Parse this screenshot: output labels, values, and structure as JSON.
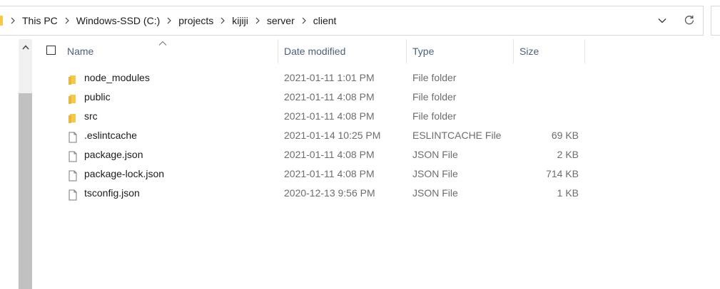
{
  "address_bar": {
    "breadcrumbs": [
      "This PC",
      "Windows-SSD (C:)",
      "projects",
      "kijiji",
      "server",
      "client"
    ]
  },
  "icons": {
    "breadcrumb_separator": "chevron-right-icon",
    "history_dropdown": "chevron-down-icon",
    "refresh": "refresh-icon",
    "sort_indicator": "sort-up-icon",
    "scroll_up": "scroll-up-arrow-icon",
    "folder": "folder-icon",
    "file": "file-icon"
  },
  "colors": {
    "folder": "#f2c94c",
    "header_text": "#4c607a",
    "secondary_text": "#6d6d6d",
    "scroll_thumb": "#c1c1c1"
  },
  "columns": {
    "name": "Name",
    "date_modified": "Date modified",
    "type": "Type",
    "size": "Size"
  },
  "files": [
    {
      "name": "node_modules",
      "date": "2021-01-11 1:01 PM",
      "type": "File folder",
      "size": "",
      "kind": "folder"
    },
    {
      "name": "public",
      "date": "2021-01-11 4:08 PM",
      "type": "File folder",
      "size": "",
      "kind": "folder"
    },
    {
      "name": "src",
      "date": "2021-01-11 4:08 PM",
      "type": "File folder",
      "size": "",
      "kind": "folder"
    },
    {
      "name": ".eslintcache",
      "date": "2021-01-14 10:25 PM",
      "type": "ESLINTCACHE File",
      "size": "69 KB",
      "kind": "file"
    },
    {
      "name": "package.json",
      "date": "2021-01-11 4:08 PM",
      "type": "JSON File",
      "size": "2 KB",
      "kind": "file"
    },
    {
      "name": "package-lock.json",
      "date": "2021-01-11 4:08 PM",
      "type": "JSON File",
      "size": "714 KB",
      "kind": "file"
    },
    {
      "name": "tsconfig.json",
      "date": "2020-12-13 9:56 PM",
      "type": "JSON File",
      "size": "1 KB",
      "kind": "file"
    }
  ]
}
